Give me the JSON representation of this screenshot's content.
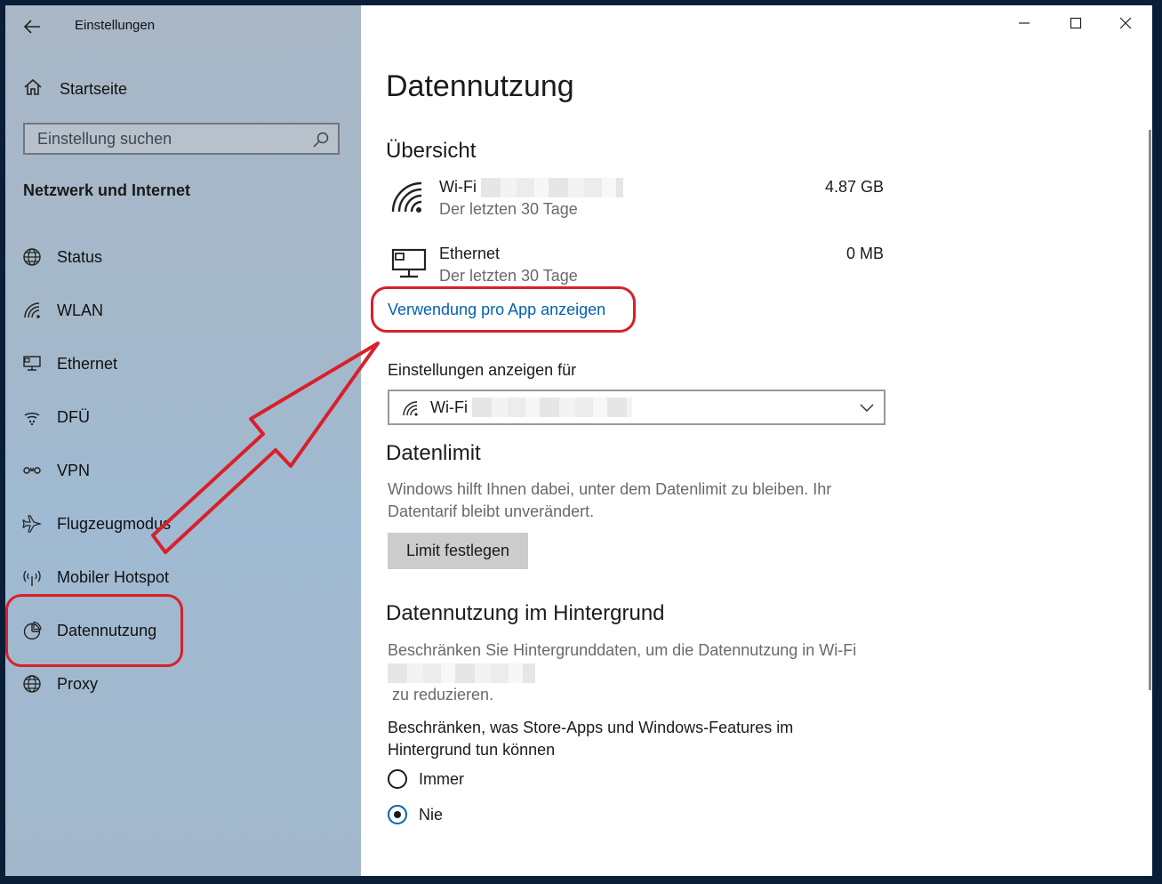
{
  "window": {
    "title": "Einstellungen",
    "controls": {
      "minimize": "minimize-icon",
      "maximize": "maximize-icon",
      "close": "close-icon"
    }
  },
  "sidebar": {
    "home_label": "Startseite",
    "search_placeholder": "Einstellung suchen",
    "section_title": "Netzwerk und Internet",
    "items": [
      {
        "label": "Status",
        "icon": "status-globe-icon"
      },
      {
        "label": "WLAN",
        "icon": "wifi-icon"
      },
      {
        "label": "Ethernet",
        "icon": "ethernet-icon"
      },
      {
        "label": "DFÜ",
        "icon": "dialup-icon"
      },
      {
        "label": "VPN",
        "icon": "vpn-icon"
      },
      {
        "label": "Flugzeugmodus",
        "icon": "airplane-icon"
      },
      {
        "label": "Mobiler Hotspot",
        "icon": "hotspot-icon"
      },
      {
        "label": "Datennutzung",
        "icon": "data-usage-icon",
        "selected": true
      },
      {
        "label": "Proxy",
        "icon": "proxy-globe-icon"
      }
    ]
  },
  "main": {
    "title": "Datennutzung",
    "overview": {
      "heading": "Übersicht",
      "connections": [
        {
          "name": "Wi-Fi",
          "period": "Der letzten 30 Tage",
          "amount": "4.87 GB"
        },
        {
          "name": "Ethernet",
          "period": "Der letzten 30 Tage",
          "amount": "0 MB"
        }
      ],
      "per_app_link": "Verwendung pro App anzeigen"
    },
    "settings_for": {
      "label": "Einstellungen anzeigen für",
      "selected": "Wi-Fi"
    },
    "data_limit": {
      "heading": "Datenlimit",
      "description": "Windows hilft Ihnen dabei, unter dem Datenlimit zu bleiben. Ihr Datentarif bleibt unverändert.",
      "button": "Limit festlegen"
    },
    "background": {
      "heading": "Datennutzung im Hintergrund",
      "description_1": "Beschränken Sie Hintergrunddaten, um die Datennutzung in Wi-Fi",
      "description_2": "zu reduzieren.",
      "restrict_label": "Beschränken, was Store-Apps und Windows-Features im Hintergrund tun können",
      "options": [
        {
          "label": "Immer",
          "checked": false
        },
        {
          "label": "Nie",
          "checked": true
        }
      ]
    }
  },
  "colors": {
    "accent": "#0063b1",
    "annotation": "#d8202a"
  }
}
